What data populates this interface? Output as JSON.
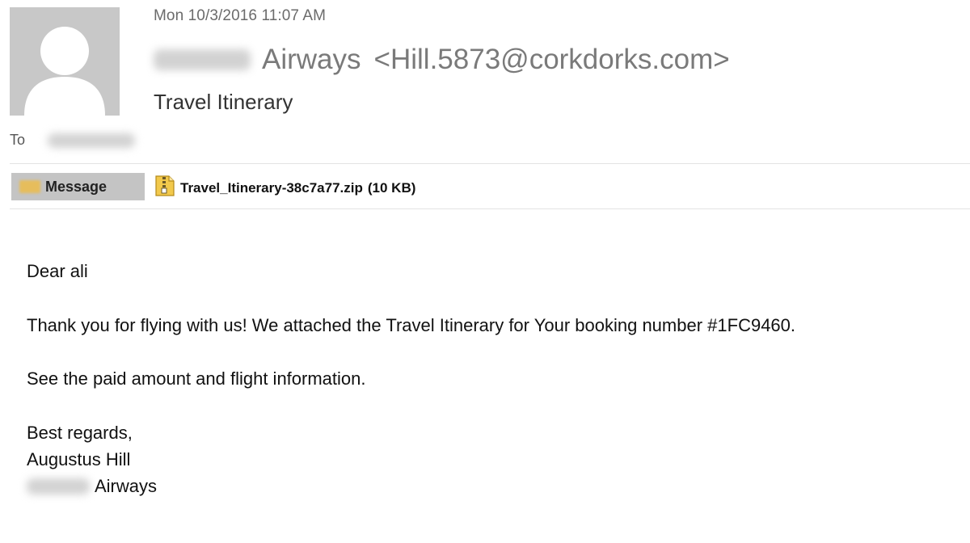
{
  "header": {
    "sent_date": "Mon 10/3/2016 11:07 AM",
    "sender_name_suffix": "Airways",
    "sender_email": "<Hill.5873@corkdorks.com>",
    "subject": "Travel Itinerary",
    "to_label": "To"
  },
  "attachments_bar": {
    "message_tab_label": "Message",
    "attachment_name": "Travel_Itinerary-38c7a77.zip",
    "attachment_size": "(10 KB)"
  },
  "body": {
    "greeting": "Dear ali",
    "thanks": "Thank you for flying with us! We attached the Travel Itinerary for Your booking number #1FC9460.",
    "see_info": "See the paid amount and flight information.",
    "regards": "Best regards,",
    "signer_name": "Augustus Hill",
    "signer_company_suffix": "Airways"
  },
  "icons": {
    "avatar": "default-person-avatar",
    "message_tab": "envelope-icon",
    "attachment": "zip-file-icon"
  },
  "colors": {
    "avatar_background": "#c8c8c8",
    "message_tab_background": "#c4c4c4",
    "zip_icon": "#f2c94c"
  }
}
